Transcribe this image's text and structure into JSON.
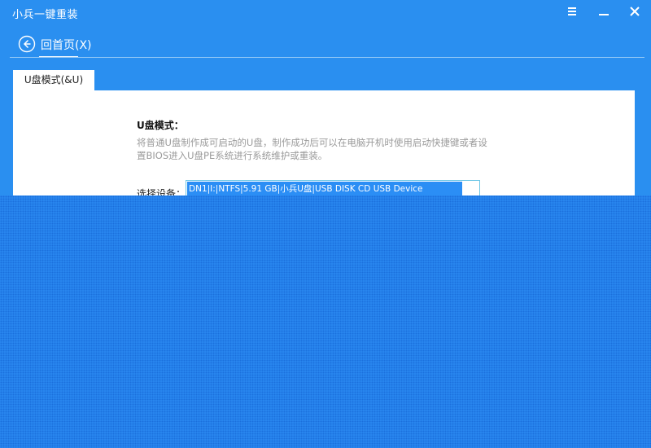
{
  "window": {
    "title": "小兵一键重装",
    "menu_icon": "menu-icon",
    "minimize_icon": "minimize-icon",
    "close_icon": "close-icon"
  },
  "nav": {
    "back_label": "回首页(X)",
    "back_icon": "back-arrow-icon"
  },
  "tabs": [
    {
      "label": "U盘模式(&U)",
      "active": true
    }
  ],
  "panel": {
    "title": "U盘模式：",
    "description": "将普通U盘制作成可启动的U盘，制作成功后可以在电脑开机时使用启动快捷键或者设置BIOS进入U盘PE系统进行系统维护或重装。",
    "device_label": "选择设备：",
    "device_value": "DN1|I:|NTFS|5.91 GB|小兵U盘|USB DISK CD USB Device"
  },
  "colors": {
    "background": "#2a8ff0",
    "panel": "#ffffff",
    "selection": "#2b8ef5",
    "description_text": "#9a9a9a"
  }
}
